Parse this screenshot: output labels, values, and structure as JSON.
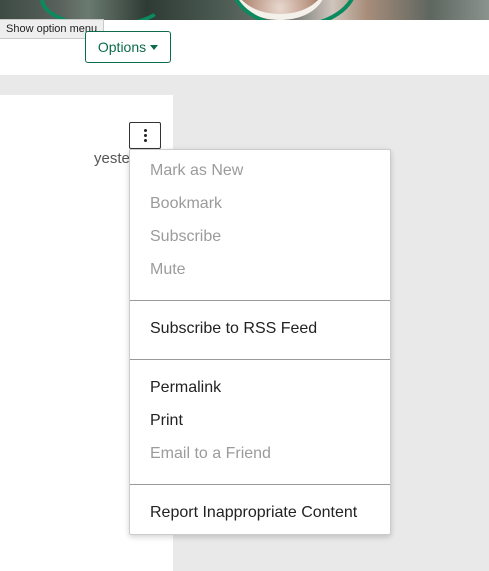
{
  "tooltip": {
    "text": "Show option menu"
  },
  "options_button": {
    "label": "Options"
  },
  "post": {
    "timestamp_partial": "yeste"
  },
  "menu": {
    "sections": [
      {
        "items": [
          {
            "label": "Mark as New",
            "enabled": false
          },
          {
            "label": "Bookmark",
            "enabled": false
          },
          {
            "label": "Subscribe",
            "enabled": false
          },
          {
            "label": "Mute",
            "enabled": false
          }
        ]
      },
      {
        "items": [
          {
            "label": "Subscribe to RSS Feed",
            "enabled": true
          }
        ]
      },
      {
        "items": [
          {
            "label": "Permalink",
            "enabled": true
          },
          {
            "label": "Print",
            "enabled": true
          },
          {
            "label": "Email to a Friend",
            "enabled": false
          }
        ]
      },
      {
        "items": [
          {
            "label": "Report Inappropriate Content",
            "enabled": true
          }
        ]
      }
    ]
  },
  "colors": {
    "accent": "#0d6b4d",
    "disabled_text": "#9b9b9b",
    "page_gray": "#e9e9e9"
  },
  "icons": {
    "options_caret": "caret-down-icon",
    "menu_trigger": "vertical-ellipsis-icon"
  }
}
